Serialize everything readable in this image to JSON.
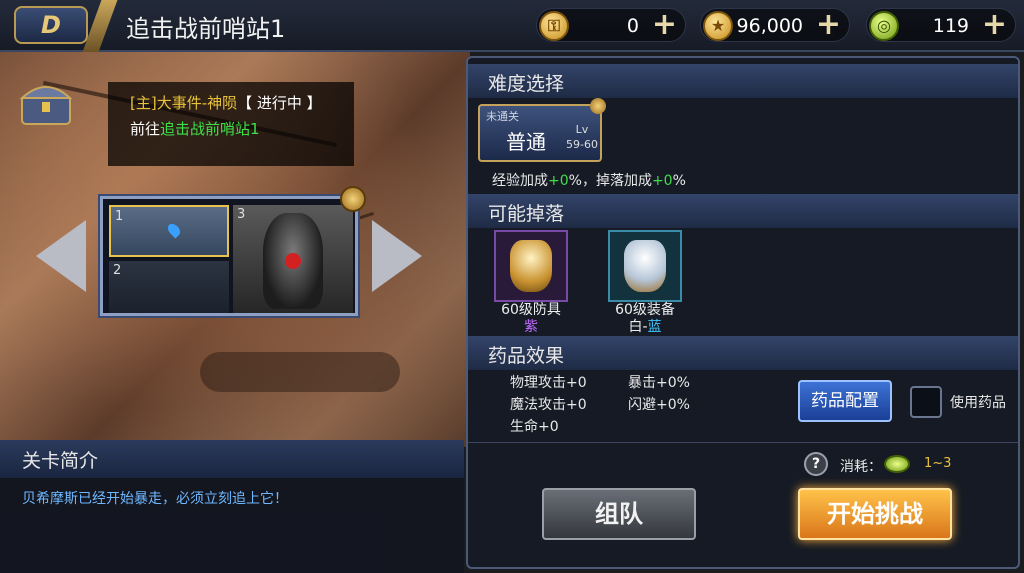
{
  "header": {
    "back_label": "D",
    "title": "追击战前哨站1",
    "currencies": [
      {
        "icon": "gold-lock-coin-icon",
        "value": "0"
      },
      {
        "icon": "gold-coin-icon",
        "value": "96,000"
      },
      {
        "icon": "green-coin-icon",
        "value": "119"
      }
    ],
    "plus_label": "+"
  },
  "quest": {
    "tag": "[主]大事件-神陨",
    "status": "【 进行中 】",
    "goto_prefix": "前往",
    "goto_target": "追击战前哨站1"
  },
  "stages": {
    "cell1": "1",
    "cell2": "2",
    "cell3": "3"
  },
  "intro": {
    "header": "关卡简介",
    "text": "贝希摩斯已经开始暴走，必须立刻追上它！"
  },
  "difficulty": {
    "header": "难度选择",
    "status": "未通关",
    "name": "普通",
    "lv_label": "Lv",
    "lv_range": "59-60",
    "exp_label": "经验加成",
    "exp_value": "+0",
    "exp_suffix": "%，",
    "drop_label": "掉落加成",
    "drop_value": "+0",
    "drop_suffix": "%"
  },
  "drops": {
    "header": "可能掉落",
    "items": [
      {
        "name": "60级防具",
        "quality": "紫",
        "color": "#c16bff"
      },
      {
        "name": "60级装备",
        "quality_white": "白-",
        "quality_blue": "蓝",
        "color": "#40c8ff"
      }
    ]
  },
  "potion": {
    "header": "药品效果",
    "phys": "物理攻击+0",
    "magic": "魔法攻击+0",
    "life": "生命+0",
    "crit": "暴击+0%",
    "dodge": "闪避+0%",
    "config_label": "药品配置",
    "use_label": "使用药品"
  },
  "footer": {
    "help": "?",
    "cost_label": "消耗：",
    "cost_value": "1~3",
    "team_label": "组队",
    "start_label": "开始挑战"
  }
}
